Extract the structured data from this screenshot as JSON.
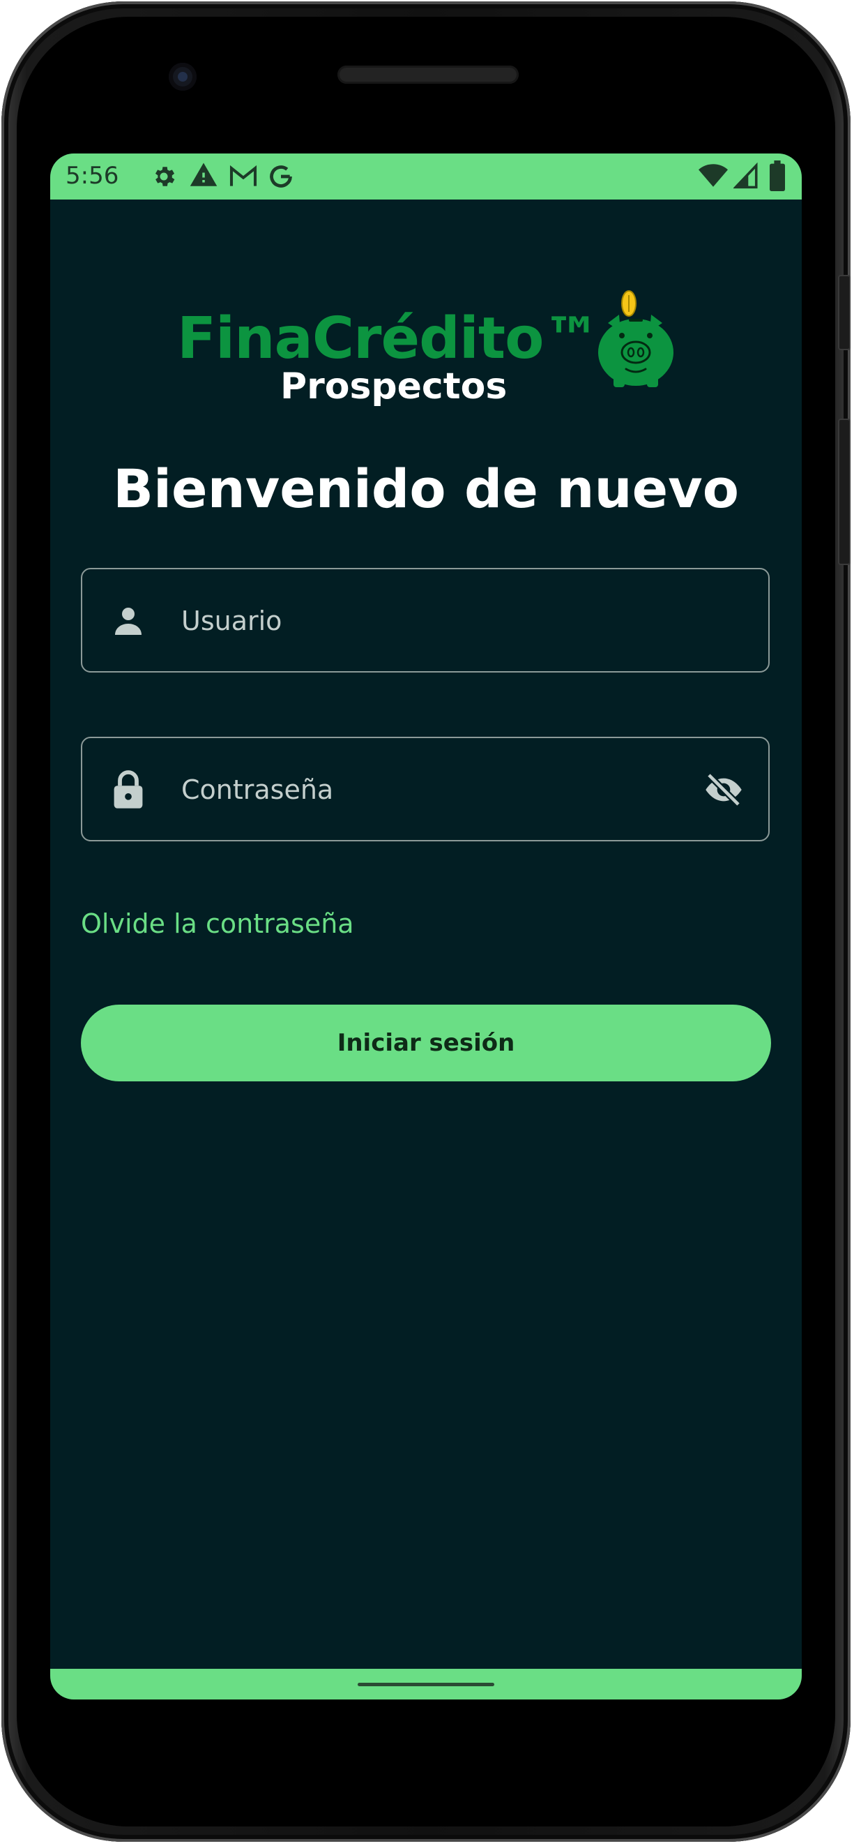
{
  "status_bar": {
    "time": "5:56",
    "left_icons": [
      "settings-icon",
      "alert-triangle-icon",
      "gmail-icon",
      "google-icon"
    ],
    "right_icons": [
      "wifi-icon",
      "cell-signal-icon",
      "battery-icon"
    ]
  },
  "logo": {
    "title": "FinaCrédito™",
    "subtitle": "Prospectos",
    "mascot": "piggy-bank-coin-icon"
  },
  "welcome_title": "Bienvenido de nuevo",
  "form": {
    "username": {
      "placeholder": "Usuario",
      "value": "",
      "icon": "person-icon"
    },
    "password": {
      "placeholder": "Contraseña",
      "value": "",
      "icon": "lock-icon",
      "toggle_icon": "eye-off-icon"
    },
    "forgot_label": "Olvide la contraseña",
    "submit_label": "Iniciar sesión"
  },
  "colors": {
    "accent": "#6ade85",
    "background": "#021e23",
    "brand_green": "#0c9440",
    "coin": "#f5c518"
  }
}
